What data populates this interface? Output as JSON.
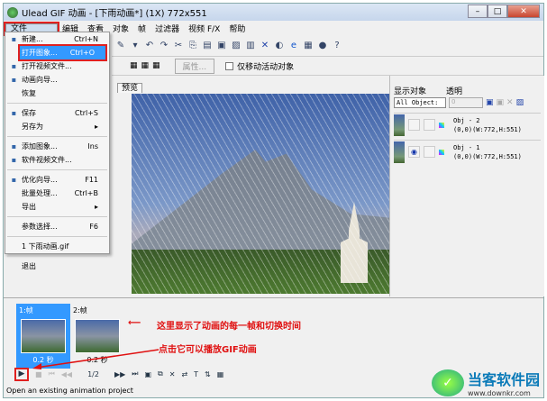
{
  "title": "Ulead GIF 动画 - [下雨动画*] (1X) 772x551",
  "window_buttons": [
    "–",
    "□",
    "✕"
  ],
  "menu": [
    "文件",
    "编辑",
    "查看",
    "对象",
    "帧",
    "过滤器",
    "视频 F/X",
    "帮助"
  ],
  "toolbar2": {
    "properties_button": "属性...",
    "move_only_active": "仅移动活动对象"
  },
  "tab_label": "预览",
  "file_menu": [
    {
      "label": "新建...",
      "shortcut": "Ctrl+N",
      "icon": "new-file-icon"
    },
    {
      "label": "打开图象...",
      "shortcut": "Ctrl+O",
      "icon": "open-icon",
      "highlight": true
    },
    {
      "label": "打开视频文件...",
      "shortcut": "",
      "icon": "open-video-icon"
    },
    {
      "label": "动画向导...",
      "shortcut": "",
      "icon": "wizard-icon"
    },
    {
      "label": "恢复",
      "shortcut": ""
    },
    {
      "sep": true
    },
    {
      "label": "保存",
      "shortcut": "Ctrl+S",
      "icon": "save-icon"
    },
    {
      "label": "另存为",
      "shortcut": "▸"
    },
    {
      "sep": true
    },
    {
      "label": "添加图象...",
      "shortcut": "Ins",
      "icon": "add-image-icon"
    },
    {
      "label": "软件视频文件...",
      "shortcut": "",
      "icon": "video-icon"
    },
    {
      "sep": true
    },
    {
      "label": "优化向导...",
      "shortcut": "F11",
      "icon": "optimize-icon"
    },
    {
      "label": "批量处理...",
      "shortcut": "Ctrl+B"
    },
    {
      "label": "导出",
      "shortcut": "▸"
    },
    {
      "sep": true
    },
    {
      "label": "参数选择...",
      "shortcut": "F6"
    },
    {
      "sep": true
    },
    {
      "label": "1 下雨动画.gif",
      "shortcut": ""
    },
    {
      "sep": true
    },
    {
      "label": "退出",
      "shortcut": ""
    }
  ],
  "object_panel": {
    "show_label": "显示对象",
    "opacity_label": "透明",
    "show_select": "All Object:",
    "opacity_value": "0",
    "objects": [
      {
        "name": "Obj - 2",
        "info": "(0,0)(W:772,H:551)",
        "visible": false
      },
      {
        "name": "Obj - 1",
        "info": "(0,0)(W:772,H:551)",
        "visible": true
      }
    ]
  },
  "frames": [
    {
      "label": "1:帧",
      "time": "0.2 秒"
    },
    {
      "label": "2:帧",
      "time": "0.2 秒"
    }
  ],
  "annotations": {
    "frames_note": "这里显示了动画的每一帧和切换时间",
    "play_note": "点击它可以播放GIF动画"
  },
  "frame_counter": "1/2",
  "status": "Open an existing animation project",
  "watermark": {
    "name": "当客软件园",
    "url": "www.downkr.com"
  }
}
